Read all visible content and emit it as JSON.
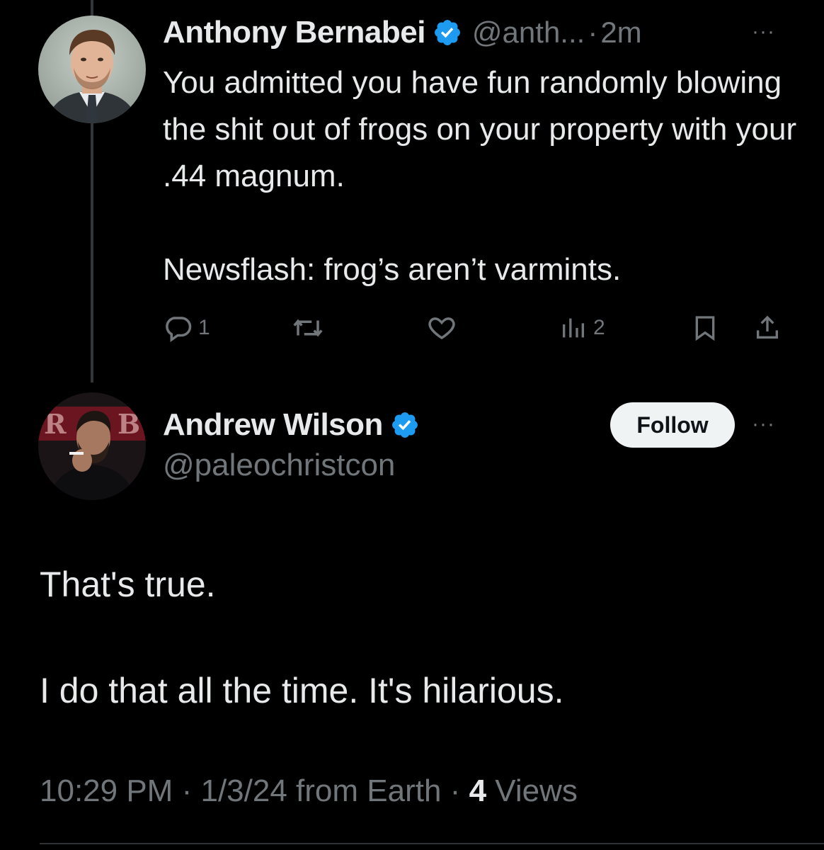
{
  "reply_tweet": {
    "author_name": "Anthony Bernabei",
    "handle": "@anth...",
    "separator": "·",
    "time_ago": "2m",
    "more_label": "···",
    "text_paragraphs": [
      "You admitted you have fun randomly blowing the shit out of frogs on your property with your .44 magnum.",
      "Newsflash: frog’s aren’t varmints."
    ],
    "actions": {
      "reply_count": "1",
      "retweet_count": "",
      "like_count": "",
      "views_count": "2"
    }
  },
  "main_tweet": {
    "author_name": "Andrew Wilson",
    "handle": "@paleochristcon",
    "follow_label": "Follow",
    "more_label": "···",
    "text_paragraphs": [
      "That's true.",
      "I do that all the time. It's hilarious."
    ],
    "meta": {
      "time": "10:29 PM",
      "separator": "·",
      "date": "1/3/24",
      "source": "from Earth",
      "views_count": "4",
      "views_label": "Views"
    }
  },
  "icons": {
    "verified": "verified-badge-icon",
    "reply": "reply-icon",
    "retweet": "retweet-icon",
    "like": "heart-icon",
    "views": "views-icon",
    "bookmark": "bookmark-icon",
    "share": "share-icon",
    "more": "more-icon"
  },
  "colors": {
    "background": "#000000",
    "text_primary": "#e7e9ea",
    "text_secondary": "#71767b",
    "verified_blue": "#1d9bf0",
    "follow_button_bg": "#eff3f4",
    "thread_line": "#333639"
  }
}
